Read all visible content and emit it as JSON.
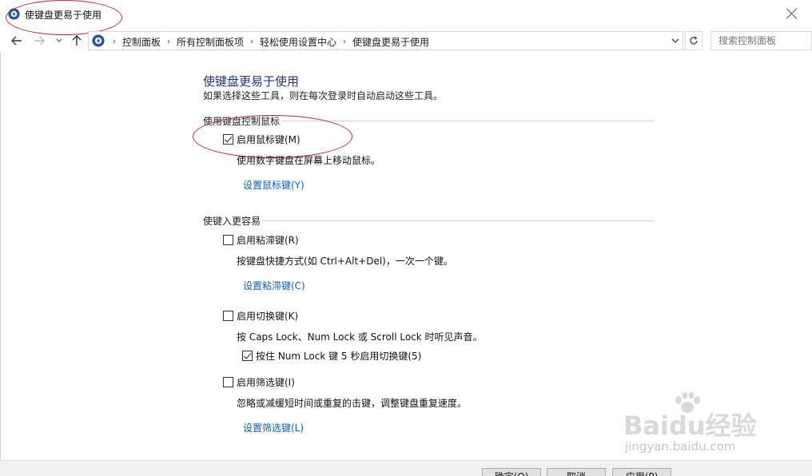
{
  "window": {
    "title": "使键盘更易于使用"
  },
  "nav": {
    "back_icon": "arrow-left-icon",
    "forward_icon": "arrow-right-icon",
    "up_icon": "arrow-up-icon",
    "breadcrumbs": [
      "控制面板",
      "所有控制面板项",
      "轻松使用设置中心",
      "使键盘更易于使用"
    ],
    "search_placeholder": "搜索控制面板"
  },
  "page": {
    "title": "使键盘更易于使用",
    "description": "如果选择这些工具，则在每次登录时自动启动这些工具。"
  },
  "mouse_section": {
    "heading": "使用键盘控制鼠标",
    "mouse_keys": {
      "label": "启用鼠标键(M)",
      "checked": true,
      "description": "使用数字键盘在屏幕上移动鼠标。",
      "link": "设置鼠标键(Y)"
    }
  },
  "typing_section": {
    "heading": "使键入更容易",
    "sticky_keys": {
      "label": "启用粘滞键(R)",
      "checked": false,
      "description": "按键盘快捷方式(如 Ctrl+Alt+Del)，一次一个键。",
      "link": "设置粘滞键(C)"
    },
    "toggle_keys": {
      "label": "启用切换键(K)",
      "checked": false,
      "description": "按 Caps Lock、Num Lock 或 Scroll Lock 时听见声音。",
      "sub_option": {
        "label": "按住 Num Lock 键 5 秒启用切换键(5)",
        "checked": true
      }
    },
    "filter_keys": {
      "label": "启用筛选键(I)",
      "checked": false,
      "description": "忽略或减缓短时间或重复的击键，调整键盘重复速度。",
      "link": "设置筛选键(L)"
    }
  },
  "buttons": {
    "ok": "确定(O)",
    "cancel": "取消",
    "apply": "应用(P)"
  },
  "watermark": {
    "main": "Baidu经验",
    "sub": "jingyan.baidu.com"
  },
  "colors": {
    "title_blue": "#1e3287",
    "link_blue": "#0a5fc8",
    "annotation_red": "#c0262c"
  }
}
